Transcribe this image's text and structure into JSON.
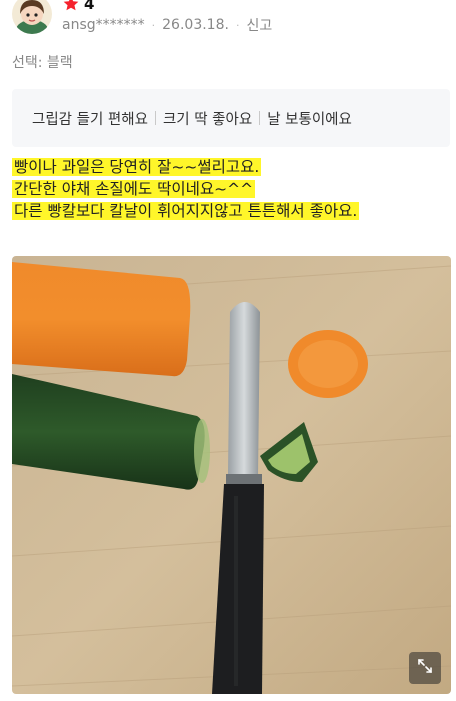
{
  "review": {
    "rating": "4",
    "author": "ansg*******",
    "date": "26.03.18.",
    "report_label": "신고",
    "option_label": "선택: 블랙",
    "tags": [
      "그립감 들기 편해요",
      "크기 딱 좋아요",
      "날 보통이에요"
    ],
    "text_lines": [
      "빵이나 과일은 당연히 잘~~썰리고요.",
      "간단한 야채 손질에도 딱이네요~^^",
      "다른 빵칼보다 칼날이 휘어지지않고 튼튼해서 좋아요."
    ]
  },
  "icons": {
    "star": "star-icon",
    "expand": "expand-icon"
  },
  "colors": {
    "star": "#f5222d",
    "highlight": "#fff62a",
    "tag_box_bg": "#f6f7f9",
    "meta_text": "#888888"
  }
}
